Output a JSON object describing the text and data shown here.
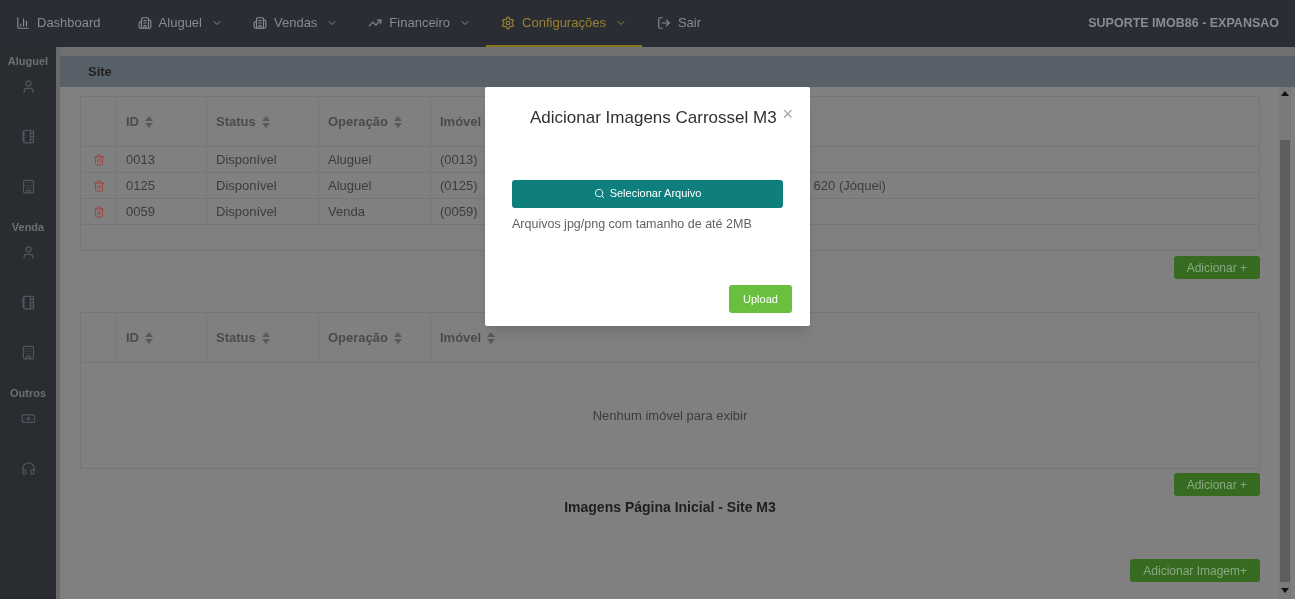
{
  "nav": {
    "items": [
      {
        "label": "Dashboard",
        "dropdown": false,
        "selected": false
      },
      {
        "label": "Aluguel",
        "dropdown": true,
        "selected": false
      },
      {
        "label": "Vendas",
        "dropdown": true,
        "selected": false
      },
      {
        "label": "Financeiro",
        "dropdown": true,
        "selected": false
      },
      {
        "label": "Configurações",
        "dropdown": true,
        "selected": true
      },
      {
        "label": "Sair",
        "dropdown": false,
        "selected": false
      }
    ],
    "account": "SUPORTE IMOB86 - EXPANSAO"
  },
  "sidebar": {
    "sections": [
      {
        "title": "Aluguel"
      },
      {
        "title": "Venda"
      },
      {
        "title": "Outros"
      }
    ]
  },
  "page_header": "Site",
  "table_1": {
    "columns": [
      "ID",
      "Status",
      "Operação",
      "Imóvel"
    ],
    "rows": [
      {
        "id": "0013",
        "status": "Disponível",
        "operacao": "Aluguel",
        "imovel": "(0013)"
      },
      {
        "id": "0125",
        "status": "Disponível",
        "operacao": "Aluguel",
        "imovel": "(0125)",
        "imovel_right": "620 (Jóquei)"
      },
      {
        "id": "0059",
        "status": "Disponível",
        "operacao": "Venda",
        "imovel": "(0059)"
      }
    ],
    "add_button": "Adicionar +"
  },
  "table_2": {
    "columns": [
      "ID",
      "Status",
      "Operação",
      "Imóvel"
    ],
    "empty_message": "Nenhum imóvel para exibir",
    "add_button": "Adicionar +"
  },
  "section_title": "Imagens Página Inicial - Site M3",
  "add_image_button": "Adicionar Imagem+",
  "modal": {
    "title": "Adicionar Imagens Carrossel M3",
    "close": "×",
    "select_button": "Selecionar Arquivo",
    "hint": "Arquivos jpg/png com tamanho de até 2MB",
    "upload_button": "Upload"
  }
}
